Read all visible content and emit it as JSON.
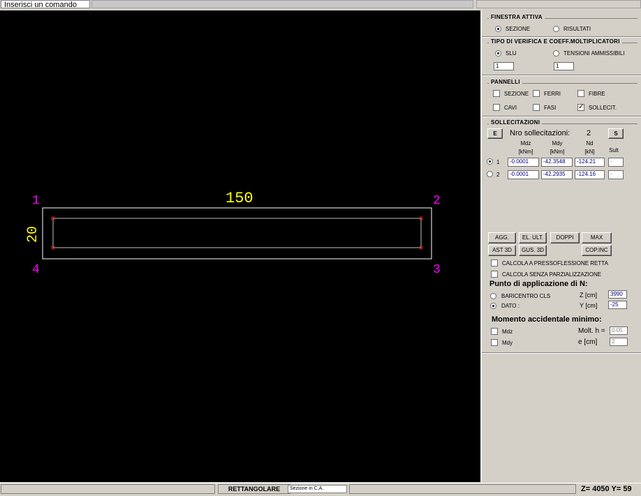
{
  "command_bar": {
    "input_value": "Inserisci un comando"
  },
  "canvas": {
    "dim_width": "150",
    "dim_height": "20",
    "corners": [
      "1",
      "2",
      "3",
      "4"
    ],
    "colors": {
      "background": "#000000",
      "outline": "#ffffff",
      "dimension": "#ffff00",
      "corner_label": "#ff00ff",
      "bar_point": "#ff0000",
      "inner_line": "#c0c0c0"
    }
  },
  "panel": {
    "finestra_attiva": {
      "title": "FINESTRA ATTIVA",
      "opt_sezione": "SEZIONE",
      "opt_risultati": "RISULTATI",
      "selected": "SEZIONE"
    },
    "tipo_verifica": {
      "title": "TIPO DI VERIFICA E COEFF.MOLTIPLICATORI",
      "opt_slu": "SLU",
      "opt_tensioni": "TENSIONI AMMISSIBILI",
      "selected": "SLU",
      "coeff_slu": "1",
      "coeff_tensioni": "1"
    },
    "pannelli": {
      "title": "PANNELLI",
      "items": [
        {
          "label": "SEZIONE",
          "checked": false
        },
        {
          "label": "FERRI",
          "checked": false
        },
        {
          "label": "FIBRE",
          "checked": false
        },
        {
          "label": "CAVI",
          "checked": false
        },
        {
          "label": "FASI",
          "checked": false
        },
        {
          "label": "SOLLECIT.",
          "checked": true
        }
      ]
    },
    "sollecitazioni": {
      "title": "SOLLECITAZIONI",
      "btn_e": "E",
      "btn_s": "S",
      "nro_label": "Nro sollecitazioni:",
      "nro_value": "2",
      "col_mdz": "Mdz",
      "col_mdz_unit": "[kNm]",
      "col_mdy": "Mdy",
      "col_mdy_unit": "[kNm]",
      "col_nd": "Nd",
      "col_nd_unit": "[kN]",
      "col_sult": "Sult",
      "rows": [
        {
          "index": "1",
          "mdz": "-0.0001",
          "mdy": "-42.3548",
          "nd": "-124.21",
          "sult": "-",
          "selected": true
        },
        {
          "index": "2",
          "mdz": "-0.0001",
          "mdy": "-42.2935",
          "nd": "-124.16",
          "sult": "-",
          "selected": false
        }
      ]
    },
    "buttons": {
      "agg": "AGG.",
      "el_ult": "EL. ULT.",
      "doppi": "DOPPI",
      "max": "MAX",
      "ast3d": "AST 3D",
      "gus3d": "GUS. 3D",
      "copinc": "COP.INC"
    },
    "opzioni": {
      "pressoflessione": "CALCOLA A PRESSOFLESSIONE RETTA",
      "senza_parz": "CALCOLA SENZA PARZIALIZZAZIONE"
    },
    "punto_applicazione": {
      "title": "Punto di applicazione di N:",
      "opt_baricentro": "BARICENTRO CLS",
      "opt_dato": "DATO :",
      "selected": "DATO :",
      "z_label": "Z [cm]",
      "z_value": "3990",
      "y_label": "Y [cm]",
      "y_value": "-25"
    },
    "momento_accidentale": {
      "title": "Momento accidentale minimo:",
      "chk_mdz": "Mdz",
      "chk_mdy": "Mdy",
      "molt_label": "Molt. h =",
      "molt_value": "0.05",
      "e_label": "e [cm]",
      "e_value": "2"
    }
  },
  "status_bar": {
    "shape": "RETTANGOLARE",
    "section_type": "Sezione in C.A.",
    "coords": "Z= 4050 Y= 59"
  }
}
